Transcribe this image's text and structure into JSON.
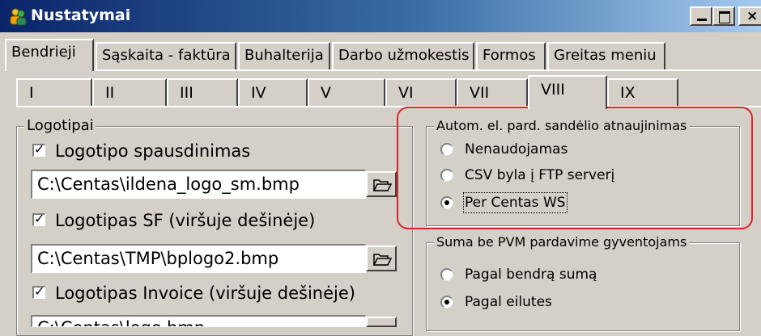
{
  "window": {
    "title": "Nustatymai",
    "controls": [
      "minimize",
      "maximize",
      "close"
    ]
  },
  "main_tabs": [
    "Bendrieji",
    "Sąskaita - faktūra",
    "Buhalterija",
    "Darbo užmokestis",
    "Formos",
    "Greitas meniu"
  ],
  "main_tabs_selected": "Bendrieji",
  "sub_tabs": [
    "I",
    "II",
    "III",
    "IV",
    "V",
    "VI",
    "VII",
    "VIII",
    "IX"
  ],
  "sub_tabs_selected": "VIII",
  "logotipai": {
    "legend": "Logotipai",
    "items": [
      {
        "label": "Logotipo spausdinimas",
        "checked": true,
        "path": "C:\\Centas\\ildena_logo_sm.bmp"
      },
      {
        "label": "Logotipas SF (viršuje dešinėje)",
        "checked": true,
        "path": "C:\\Centas\\TMP\\bplogo2.bmp"
      },
      {
        "label": "Logotipas Invoice (viršuje dešinėje)",
        "checked": true,
        "path": "C:\\Centas\\logo.bmp"
      }
    ]
  },
  "autom": {
    "legend": "Autom. el. pard. sandėlio atnaujinimas",
    "options": [
      "Nenaudojamas",
      "CSV byla į FTP serverį",
      "Per Centas WS"
    ],
    "selected": "Per Centas WS"
  },
  "suma": {
    "legend": "Suma be PVM pardavime gyventojams",
    "options": [
      "Pagal bendrą sumą",
      "Pagal eilutes"
    ],
    "selected": "Pagal eilutes"
  },
  "highlight_color": "#e0242a"
}
